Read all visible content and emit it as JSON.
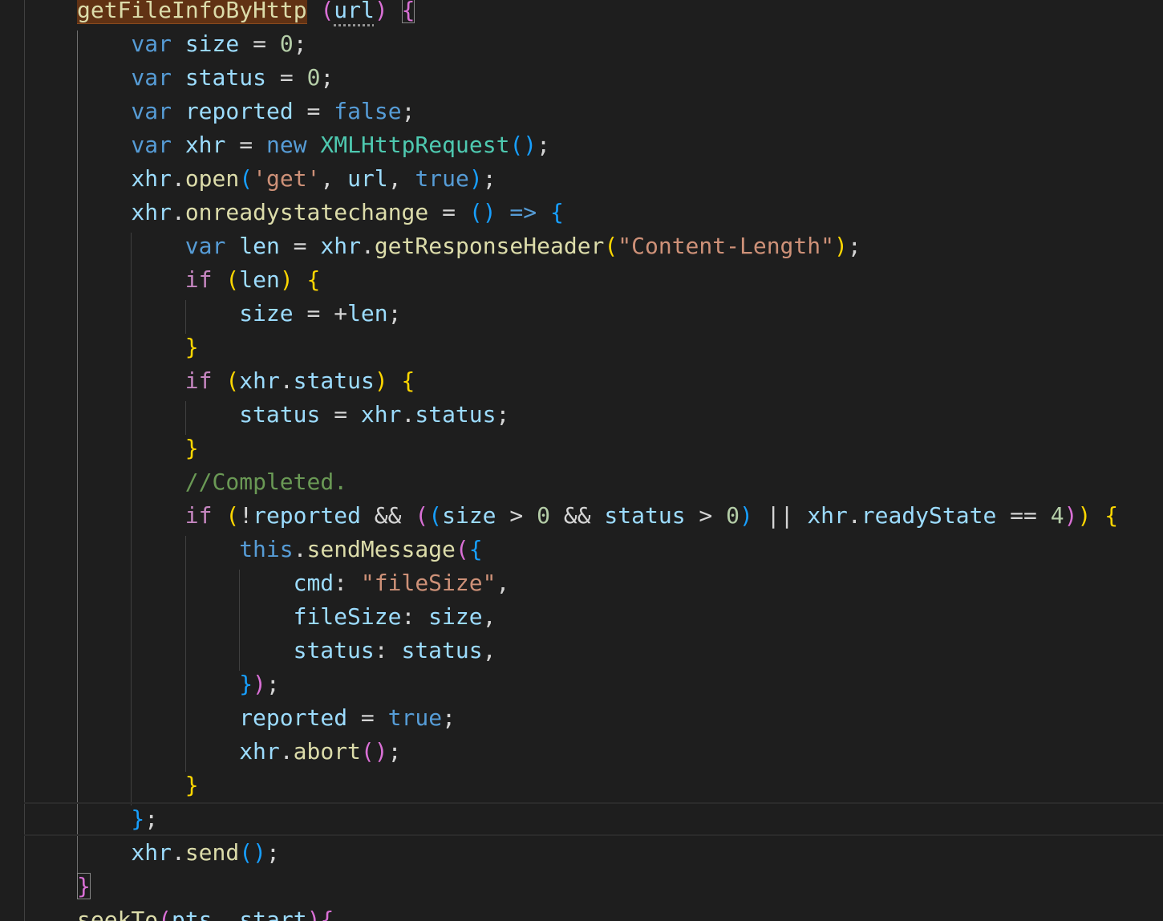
{
  "editor": {
    "theme_colors": {
      "background": "#1e1e1e",
      "keyword": "#569cd6",
      "control": "#c586c0",
      "variable": "#9cdcfe",
      "function": "#dcdcaa",
      "class": "#4ec9b0",
      "string": "#ce9178",
      "number": "#b5cea8",
      "comment": "#6a9955",
      "bracket_level_1": "#ffd700",
      "bracket_level_2": "#da70d6",
      "bracket_level_3": "#179fff",
      "highlight": "#613214"
    },
    "lines": [
      {
        "tokens": [
          [
            "fn",
            "getFileInfoByHttp",
            "hl"
          ],
          [
            "op",
            " "
          ],
          [
            "b2",
            "("
          ],
          [
            "var",
            "url",
            "hint"
          ],
          [
            "b2",
            ")"
          ],
          [
            "op",
            " "
          ],
          [
            "b2",
            "{",
            "match"
          ]
        ]
      },
      {
        "tokens": [
          [
            "kw",
            "var"
          ],
          [
            "op",
            " "
          ],
          [
            "var",
            "size"
          ],
          [
            "op",
            " = "
          ],
          [
            "num",
            "0"
          ],
          [
            "op",
            ";"
          ]
        ]
      },
      {
        "tokens": [
          [
            "kw",
            "var"
          ],
          [
            "op",
            " "
          ],
          [
            "var",
            "status"
          ],
          [
            "op",
            " = "
          ],
          [
            "num",
            "0"
          ],
          [
            "op",
            ";"
          ]
        ]
      },
      {
        "tokens": [
          [
            "kw",
            "var"
          ],
          [
            "op",
            " "
          ],
          [
            "var",
            "reported"
          ],
          [
            "op",
            " = "
          ],
          [
            "kw",
            "false"
          ],
          [
            "op",
            ";"
          ]
        ]
      },
      {
        "tokens": [
          [
            "kw",
            "var"
          ],
          [
            "op",
            " "
          ],
          [
            "var",
            "xhr"
          ],
          [
            "op",
            " = "
          ],
          [
            "kw",
            "new"
          ],
          [
            "op",
            " "
          ],
          [
            "cls",
            "XMLHttpRequest"
          ],
          [
            "b3",
            "()"
          ],
          [
            "op",
            ";"
          ]
        ]
      },
      {
        "tokens": [
          [
            "var",
            "xhr"
          ],
          [
            "op",
            "."
          ],
          [
            "fn",
            "open"
          ],
          [
            "b3",
            "("
          ],
          [
            "str",
            "'get'"
          ],
          [
            "op",
            ", "
          ],
          [
            "var",
            "url"
          ],
          [
            "op",
            ", "
          ],
          [
            "kw",
            "true"
          ],
          [
            "b3",
            ")"
          ],
          [
            "op",
            ";"
          ]
        ]
      },
      {
        "tokens": [
          [
            "var",
            "xhr"
          ],
          [
            "op",
            "."
          ],
          [
            "fn",
            "onreadystatechange"
          ],
          [
            "op",
            " = "
          ],
          [
            "b3",
            "()"
          ],
          [
            "op",
            " "
          ],
          [
            "kw",
            "=>"
          ],
          [
            "op",
            " "
          ],
          [
            "b3",
            "{"
          ]
        ]
      },
      {
        "tokens": [
          [
            "kw",
            "var"
          ],
          [
            "op",
            " "
          ],
          [
            "var",
            "len"
          ],
          [
            "op",
            " = "
          ],
          [
            "var",
            "xhr"
          ],
          [
            "op",
            "."
          ],
          [
            "fn",
            "getResponseHeader"
          ],
          [
            "b1",
            "("
          ],
          [
            "str",
            "\"Content-Length\""
          ],
          [
            "b1",
            ")"
          ],
          [
            "op",
            ";"
          ]
        ]
      },
      {
        "tokens": [
          [
            "ctl",
            "if"
          ],
          [
            "op",
            " "
          ],
          [
            "b1",
            "("
          ],
          [
            "var",
            "len"
          ],
          [
            "b1",
            ")"
          ],
          [
            "op",
            " "
          ],
          [
            "b1",
            "{"
          ]
        ]
      },
      {
        "tokens": [
          [
            "var",
            "size"
          ],
          [
            "op",
            " = +"
          ],
          [
            "var",
            "len"
          ],
          [
            "op",
            ";"
          ]
        ]
      },
      {
        "tokens": [
          [
            "b1",
            "}"
          ]
        ]
      },
      {
        "tokens": [
          [
            "ctl",
            "if"
          ],
          [
            "op",
            " "
          ],
          [
            "b1",
            "("
          ],
          [
            "var",
            "xhr"
          ],
          [
            "op",
            "."
          ],
          [
            "var",
            "status"
          ],
          [
            "b1",
            ")"
          ],
          [
            "op",
            " "
          ],
          [
            "b1",
            "{"
          ]
        ]
      },
      {
        "tokens": [
          [
            "var",
            "status"
          ],
          [
            "op",
            " = "
          ],
          [
            "var",
            "xhr"
          ],
          [
            "op",
            "."
          ],
          [
            "var",
            "status"
          ],
          [
            "op",
            ";"
          ]
        ]
      },
      {
        "tokens": [
          [
            "b1",
            "}"
          ]
        ]
      },
      {
        "tokens": [
          [
            "cmt",
            "//Completed."
          ]
        ]
      },
      {
        "tokens": [
          [
            "ctl",
            "if"
          ],
          [
            "op",
            " "
          ],
          [
            "b1",
            "("
          ],
          [
            "op",
            "!"
          ],
          [
            "var",
            "reported"
          ],
          [
            "op",
            " && "
          ],
          [
            "b2",
            "("
          ],
          [
            "b3",
            "("
          ],
          [
            "var",
            "size"
          ],
          [
            "op",
            " > "
          ],
          [
            "num",
            "0"
          ],
          [
            "op",
            " && "
          ],
          [
            "var",
            "status"
          ],
          [
            "op",
            " > "
          ],
          [
            "num",
            "0"
          ],
          [
            "b3",
            ")"
          ],
          [
            "op",
            " || "
          ],
          [
            "var",
            "xhr"
          ],
          [
            "op",
            "."
          ],
          [
            "var",
            "readyState"
          ],
          [
            "op",
            " == "
          ],
          [
            "num",
            "4"
          ],
          [
            "b2",
            ")"
          ],
          [
            "b1",
            ")"
          ],
          [
            "op",
            " "
          ],
          [
            "b1",
            "{"
          ]
        ]
      },
      {
        "tokens": [
          [
            "kw",
            "this"
          ],
          [
            "op",
            "."
          ],
          [
            "fn",
            "sendMessage"
          ],
          [
            "b2",
            "("
          ],
          [
            "b3",
            "{"
          ]
        ]
      },
      {
        "tokens": [
          [
            "var",
            "cmd"
          ],
          [
            "op",
            ": "
          ],
          [
            "str",
            "\"fileSize\""
          ],
          [
            "op",
            ","
          ]
        ]
      },
      {
        "tokens": [
          [
            "var",
            "fileSize"
          ],
          [
            "op",
            ": "
          ],
          [
            "var",
            "size"
          ],
          [
            "op",
            ","
          ]
        ]
      },
      {
        "tokens": [
          [
            "var",
            "status"
          ],
          [
            "op",
            ": "
          ],
          [
            "var",
            "status"
          ],
          [
            "op",
            ","
          ]
        ]
      },
      {
        "tokens": [
          [
            "b3",
            "}"
          ],
          [
            "b2",
            ")"
          ],
          [
            "op",
            ";"
          ]
        ]
      },
      {
        "tokens": [
          [
            "var",
            "reported"
          ],
          [
            "op",
            " = "
          ],
          [
            "kw",
            "true"
          ],
          [
            "op",
            ";"
          ]
        ]
      },
      {
        "tokens": [
          [
            "var",
            "xhr"
          ],
          [
            "op",
            "."
          ],
          [
            "fn",
            "abort"
          ],
          [
            "b2",
            "()"
          ],
          [
            "op",
            ";"
          ]
        ]
      },
      {
        "tokens": [
          [
            "b1",
            "}"
          ]
        ]
      },
      {
        "tokens": [
          [
            "b3",
            "}"
          ],
          [
            "op",
            ";"
          ]
        ]
      },
      {
        "tokens": [
          [
            "var",
            "xhr"
          ],
          [
            "op",
            "."
          ],
          [
            "fn",
            "send"
          ],
          [
            "b3",
            "()"
          ],
          [
            "op",
            ";"
          ]
        ]
      },
      {
        "tokens": [
          [
            "b2",
            "}",
            "match"
          ]
        ]
      },
      {
        "tokens": [
          [
            "fn",
            "seekTo"
          ],
          [
            "b2",
            "("
          ],
          [
            "var",
            "pts"
          ],
          [
            "op",
            ", "
          ],
          [
            "var",
            "start"
          ],
          [
            "b2",
            ")"
          ],
          [
            "b2",
            "{"
          ]
        ]
      }
    ]
  }
}
